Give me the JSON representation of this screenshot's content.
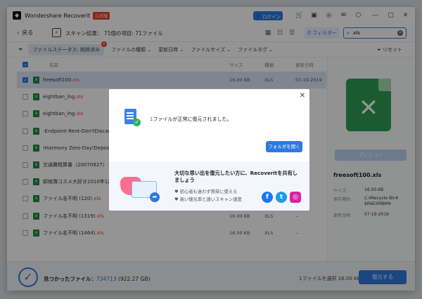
{
  "app": {
    "title": "Wondershare Recoverit",
    "badge": "ロボ版",
    "login": "ログイン"
  },
  "toolbar": {
    "back": "戻る",
    "scan_result": "スキャン結果： 71個の項目: 71ファイル",
    "filter": "フィルター",
    "search_value": ".xls"
  },
  "filters": {
    "status_chip": "ファイルステータス: 削除済み",
    "items": [
      "ファイルの種類",
      "更新日時",
      "ファイルサイズ",
      "ファイルタグ"
    ],
    "reset": "リセット"
  },
  "table": {
    "headers": {
      "name": "名前",
      "size": "サイズ",
      "type": "種類",
      "date": "更新日時"
    },
    "rows": [
      {
        "name": "freesoft100",
        "ext": ".xls",
        "size": "16.00 KB",
        "type": "XLS",
        "date": "07-19-2019",
        "checked": true
      },
      {
        "name": "eightban_lng",
        "ext": ".xls",
        "size": "",
        "type": "",
        "date": "",
        "checked": false
      },
      {
        "name": "eightban_lng",
        "ext": ".xls",
        "size": "",
        "type": "",
        "date": "",
        "checked": false
      },
      {
        "name": "-Endpoint-Rent-Don'tDiscard",
        "ext": ".",
        "size": "",
        "type": "",
        "date": "",
        "checked": false
      },
      {
        "name": "!Harmony Zero-Day!Deposit!D",
        "ext": "",
        "size": "",
        "type": "",
        "date": "",
        "checked": false
      },
      {
        "name": "交通費精算書（20070927）",
        "ext": ".",
        "size": "",
        "type": "",
        "date": "",
        "checked": false
      },
      {
        "name": "卸格簿コスメ大好き2010年1月",
        "ext": ".",
        "size": "",
        "type": "",
        "date": "",
        "checked": false
      },
      {
        "name": "ファイル名不明 (120)",
        "ext": ".xls",
        "size": "",
        "type": "",
        "date": "",
        "checked": false
      },
      {
        "name": "ファイル名不明 (1319)",
        "ext": ".xls",
        "size": "16.00 KB",
        "type": "XLS",
        "date": "--",
        "checked": false
      },
      {
        "name": "ファイル名不明 (1464)",
        "ext": ".xls",
        "size": "16.00 KB",
        "type": "XLS",
        "date": "--",
        "checked": false
      }
    ]
  },
  "side": {
    "preview": "プレビュー",
    "filename": "freesoft100.xls",
    "size_label": "サイズ:",
    "size": "16.00 KB",
    "path_label": "保存場所:",
    "path": "C:¥Recycle Bin¥$RAEXMBM¥",
    "date_label": "更新日時:",
    "date": "07-19-2019"
  },
  "bottom": {
    "found_label": "見つかったファイル：",
    "found_count": "734713",
    "found_size": "(922.27 GB)",
    "selected": "1ファイルを選択  16.00 KB",
    "recover": "復元する"
  },
  "dialog": {
    "msg_prefix": "1",
    "msg_rest": "ファイルが正常に復元されました。",
    "open_folder": "フォルダを開く",
    "share_title": "大切な思い出を復元したい方に、Recoveritを共有しましょう",
    "bullet1": "♥ 初心者も迷わず簡単に使える",
    "bullet2": "♥ 高い復元率と速いスキャン速度"
  }
}
